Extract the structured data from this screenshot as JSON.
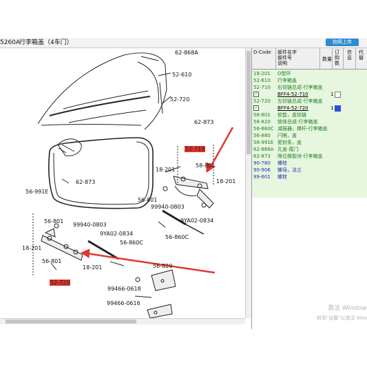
{
  "title_bar": {
    "code": "5260A",
    "title": "行李箱盖（4车门）",
    "upload_label": "拍照上传"
  },
  "diagram": {
    "labels": [
      {
        "id": "62-868A",
        "text": "62-868A"
      },
      {
        "id": "52-610",
        "text": "52-610"
      },
      {
        "id": "52-720a",
        "text": "52-720"
      },
      {
        "id": "62-873a",
        "text": "62-873"
      },
      {
        "id": "62-873b",
        "text": "62-873"
      },
      {
        "id": "52-710",
        "text": "52-710"
      },
      {
        "id": "58-801a",
        "text": "58-801"
      },
      {
        "id": "18-201a",
        "text": "18-201"
      },
      {
        "id": "18-201b",
        "text": "18-201"
      },
      {
        "id": "56-991E",
        "text": "56-991E"
      },
      {
        "id": "56-801a",
        "text": "56-801"
      },
      {
        "id": "99940-0803a",
        "text": "99940-0803"
      },
      {
        "id": "9YA02-0834a",
        "text": "9YA02-0834"
      },
      {
        "id": "56-860Ca",
        "text": "56-860C"
      },
      {
        "id": "56-801b",
        "text": "56-801"
      },
      {
        "id": "99940-0803b",
        "text": "99940-0803"
      },
      {
        "id": "9YA02-0834b",
        "text": "9YA02-0834"
      },
      {
        "id": "56-860Cb",
        "text": "56-860C"
      },
      {
        "id": "18-201c",
        "text": "18-201"
      },
      {
        "id": "56-801c",
        "text": "56-801"
      },
      {
        "id": "18-201d",
        "text": "18-201"
      },
      {
        "id": "56-820",
        "text": "56-820"
      },
      {
        "id": "52-720b",
        "text": "52-720"
      },
      {
        "id": "99466-0618a",
        "text": "99466-0618"
      },
      {
        "id": "99466-0616",
        "text": "99466-0616"
      }
    ]
  },
  "parts_panel": {
    "headers": [
      "D-Code",
      "部件名字\n部件号\n说明",
      "数量",
      "订\n购\n数",
      "信\n息",
      "代\n替"
    ],
    "rows": [
      {
        "code": "18-201",
        "name": "O型环",
        "type": "green"
      },
      {
        "code": "52-610",
        "name": "行李箱盖",
        "type": "green"
      },
      {
        "code": "52-710",
        "name": "右铰链总成-行李箱盖",
        "type": "green"
      },
      {
        "code": "✓",
        "name": "BFF4-52-710",
        "qty": "1",
        "type": "part",
        "selected": false
      },
      {
        "code": "52-720",
        "name": "左铰链总成-行李箱盖",
        "type": "green"
      },
      {
        "code": "✓",
        "name": "BFF4-52-720",
        "qty": "1",
        "type": "part",
        "selected": true
      },
      {
        "code": "56-801",
        "name": "软垫，盖铰链",
        "type": "green"
      },
      {
        "code": "56-820",
        "name": "锁体总成-行李箱盖",
        "type": "green"
      },
      {
        "code": "56-860C",
        "name": "减振器，撑杆-行李箱盖",
        "type": "green"
      },
      {
        "code": "56-880",
        "name": "闩眼，盖",
        "type": "green"
      },
      {
        "code": "56-991E",
        "name": "密封条，盖",
        "type": "green"
      },
      {
        "code": "62-868A",
        "name": "孔盖-尾门",
        "type": "green"
      },
      {
        "code": "62-873",
        "name": "限位橡胶块-行李箱盖",
        "type": "green"
      },
      {
        "code": "90-780",
        "name": "螺栓",
        "type": "blue"
      },
      {
        "code": "90-906",
        "name": "螺母，法兰",
        "type": "blue"
      },
      {
        "code": "99-601",
        "name": "螺栓",
        "type": "blue"
      }
    ]
  },
  "watermark": {
    "line1": "激活 Windows",
    "line2": "转到\"设置\"以激活 Windo"
  },
  "colors": {
    "accent_green": "#1b7f1b",
    "accent_blue": "#1a2fa8",
    "label_red": "#d9352b",
    "arrow_red": "#e0372b",
    "panel_green_bg": "#e6f6df"
  }
}
